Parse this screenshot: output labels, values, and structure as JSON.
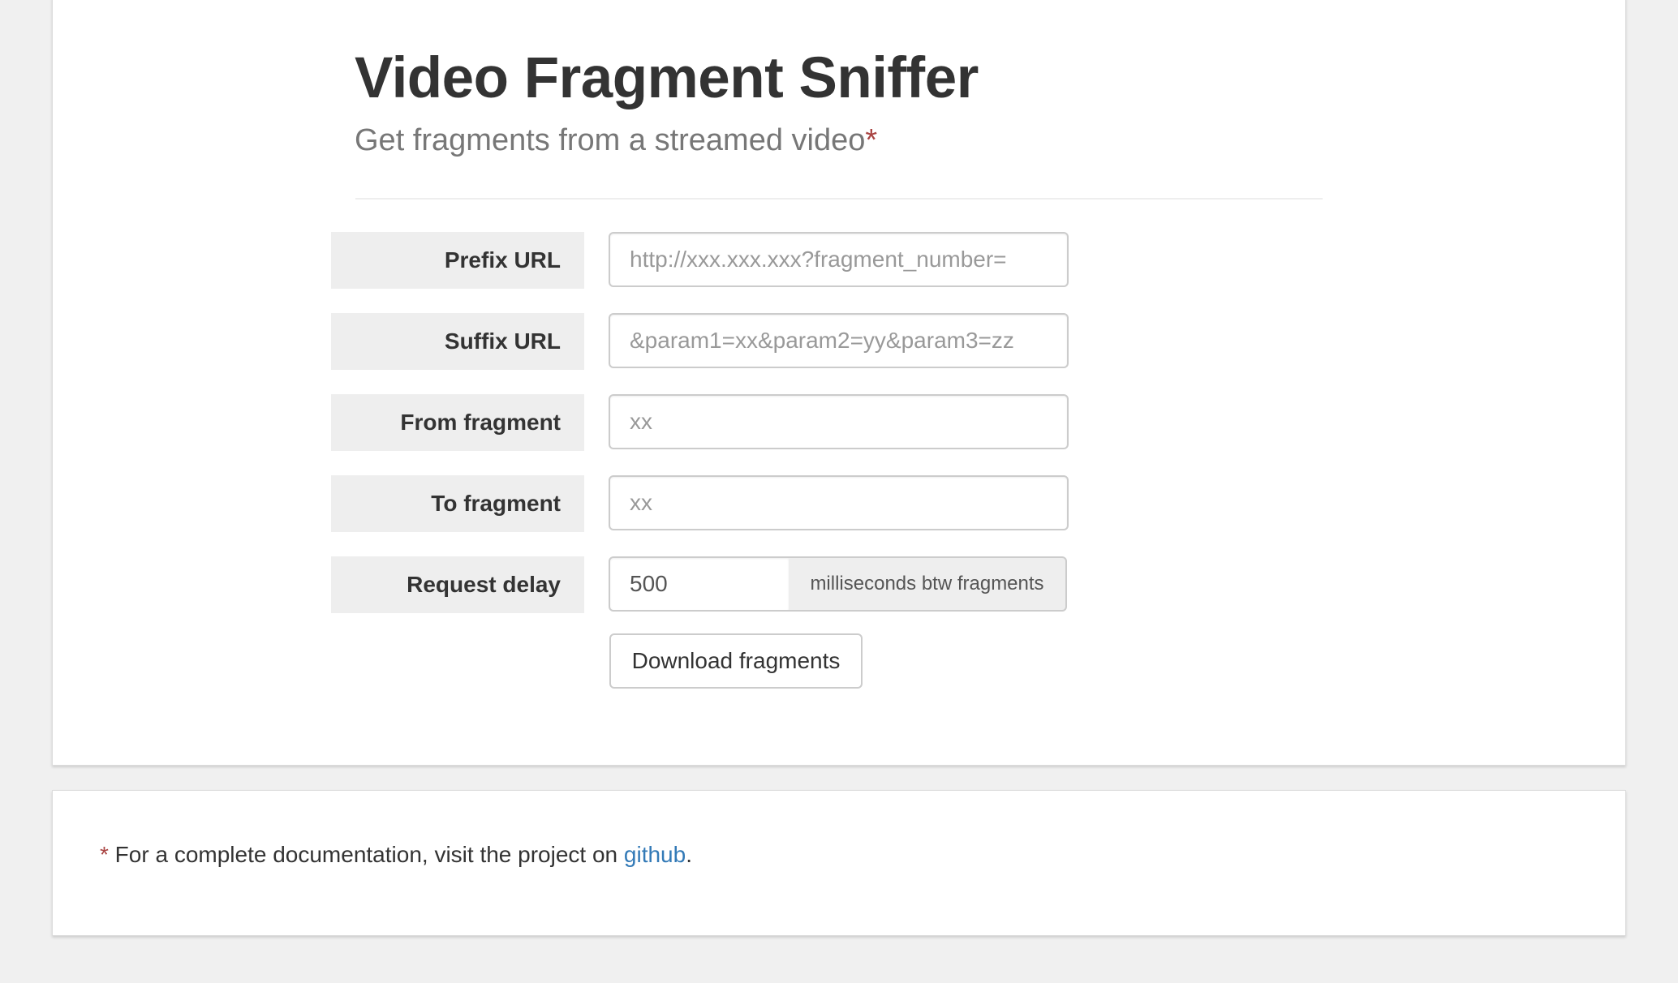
{
  "header": {
    "title": "Video Fragment Sniffer",
    "subtitle": "Get fragments from a streamed video",
    "subtitle_marker": "*"
  },
  "form": {
    "prefix_url": {
      "label": "Prefix URL",
      "value": "",
      "placeholder": "http://xxx.xxx.xxx?fragment_number="
    },
    "suffix_url": {
      "label": "Suffix URL",
      "value": "",
      "placeholder": "&param1=xx&param2=yy&param3=zz"
    },
    "from_fragment": {
      "label": "From fragment",
      "value": "",
      "placeholder": "xx"
    },
    "to_fragment": {
      "label": "To fragment",
      "value": "",
      "placeholder": "xx"
    },
    "request_delay": {
      "label": "Request delay",
      "value": "500",
      "unit": "milliseconds btw fragments"
    },
    "download_button": "Download fragments"
  },
  "footer": {
    "marker": "*",
    "text_before_link": " For a complete documentation, visit the project on ",
    "link_text": "github",
    "text_after_link": "."
  },
  "colors": {
    "background": "#f0f0f0",
    "panel": "#ffffff",
    "label_background": "#eeeeee",
    "asterisk": "#a94442",
    "link": "#337ab7"
  }
}
